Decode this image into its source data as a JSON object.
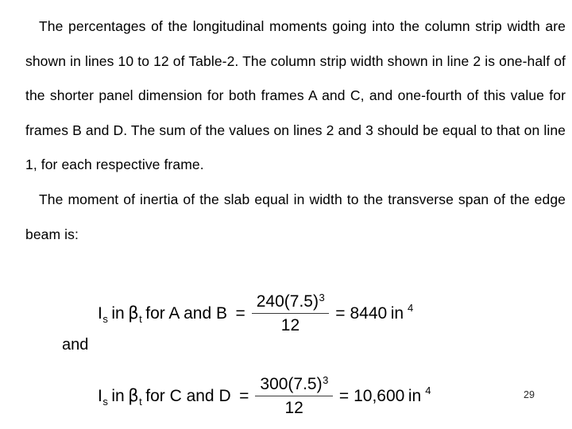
{
  "slide": {
    "background_color": "#ffffff",
    "text_color": "#000000",
    "page_number": "29"
  },
  "body": {
    "paragraphs": [
      {
        "indented": true,
        "text": "The percentages of the longitudinal moments going into the column strip width are shown in lines 10 to 12 of Table-2. The column strip width shown in line 2 is one-half of the shorter panel dimension for both frames A and C, and one-fourth of this value for frames B and D. The sum of the values on lines 2 and 3 should be equal to that on line 1, for each respective frame."
      },
      {
        "indented": true,
        "text": "The moment of inertia of the slab equal in width to the transverse span of the edge beam is:"
      }
    ]
  },
  "math": {
    "connector_label": "and",
    "equations": [
      {
        "id": "equation-1",
        "symbol": "I",
        "symbol_subscript": "s",
        "preposition": "in",
        "beta": "β",
        "beta_subscript": "t",
        "scope": "for A and B",
        "equals": "=",
        "numerator_base": "240(7.5)",
        "numerator_exponent": "3",
        "denominator": "12",
        "equals_2": "=",
        "result_value": "8440",
        "result_unit": "in",
        "result_unit_exponent": "4"
      },
      {
        "id": "equation-2",
        "symbol": "I",
        "symbol_subscript": "s",
        "preposition": "in",
        "beta": "β",
        "beta_subscript": "t",
        "scope": "for C and D",
        "equals": "=",
        "numerator_base": "300(7.5)",
        "numerator_exponent": "3",
        "denominator": "12",
        "equals_2": "=",
        "result_value": "10,600",
        "result_unit": "in",
        "result_unit_exponent": "4"
      }
    ]
  }
}
